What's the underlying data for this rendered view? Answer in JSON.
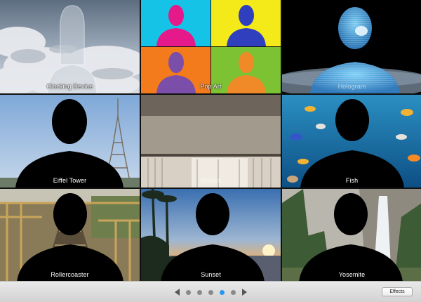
{
  "effects": [
    {
      "label": "Clocking Device"
    },
    {
      "label": "Pop Art"
    },
    {
      "label": "Hologram"
    },
    {
      "label": "Eiffel Tower"
    },
    {
      "label": "Normal"
    },
    {
      "label": "Fish"
    },
    {
      "label": "Rollercoaster"
    },
    {
      "label": "Sunset"
    },
    {
      "label": "Yosemite"
    }
  ],
  "pager": {
    "pages": 5,
    "active_page": 4
  },
  "bottom_bar": {
    "effects_button": "Effects"
  },
  "colors": {
    "active_dot": "#2b95f2",
    "inactive_dot": "#8a8a8a"
  }
}
